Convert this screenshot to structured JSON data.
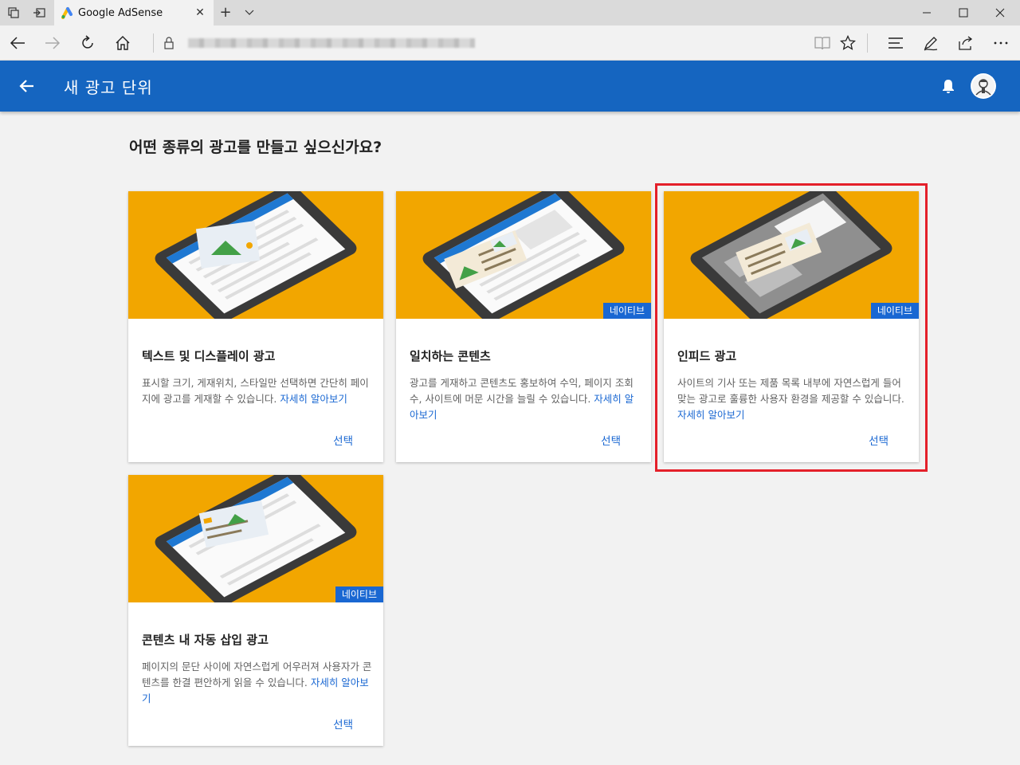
{
  "browser": {
    "tab_title": "Google AdSense",
    "new_tab_symbol": "+"
  },
  "appbar": {
    "title": "새 광고 단위"
  },
  "page": {
    "question": "어떤 종류의 광고를 만들고 싶으신가요?"
  },
  "cards": [
    {
      "title": "텍스트 및 디스플레이 광고",
      "description": "표시할 크기, 게재위치, 스타일만 선택하면 간단히 페이지에 광고를 게재할 수 있습니다. ",
      "link": "자세히 알아보기",
      "select": "선택",
      "badge": ""
    },
    {
      "title": "일치하는 콘텐츠",
      "description": "광고를 게재하고 콘텐츠도 홍보하여 수익, 페이지 조회수, 사이트에 머문 시간을 늘릴 수 있습니다. ",
      "link": "자세히 알아보기",
      "select": "선택",
      "badge": "네이티브"
    },
    {
      "title": "인피드 광고",
      "description": "사이트의 기사 또는 제품 목록 내부에 자연스럽게 들어맞는 광고로 훌륭한 사용자 환경을 제공할 수 있습니다. ",
      "link": "자세히 알아보기",
      "select": "선택",
      "badge": "네이티브"
    },
    {
      "title": "콘텐츠 내 자동 삽입 광고",
      "description": "페이지의 문단 사이에 자연스럽게 어우러져 사용자가 콘텐츠를 한결 편안하게 읽을 수 있습니다. ",
      "link": "자세히 알아보기",
      "select": "선택",
      "badge": "네이티브"
    }
  ],
  "colors": {
    "appbar": "#1565c0",
    "hero": "#f2a600",
    "badge": "#1967d2",
    "highlight": "#e4202a"
  }
}
